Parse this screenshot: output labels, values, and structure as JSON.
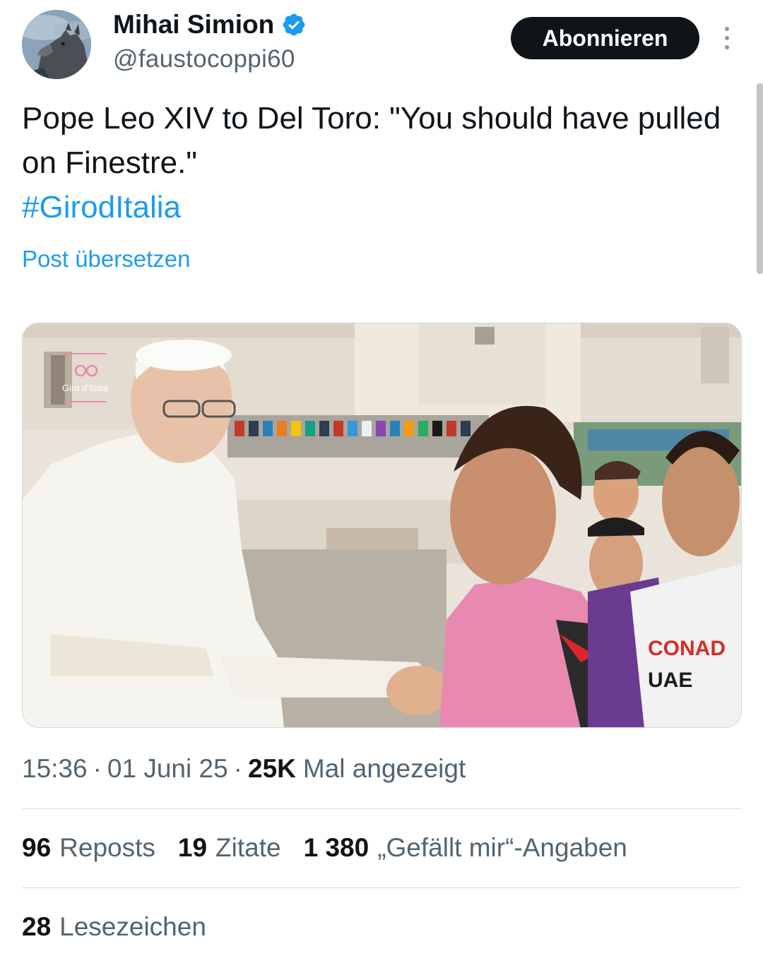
{
  "author": {
    "display_name": "Mihai Simion",
    "handle": "@faustocoppi60",
    "verified": true,
    "avatar_icon": "wolf-avatar"
  },
  "actions": {
    "follow_label": "Abonnieren",
    "more_icon": "more-vertical-icon"
  },
  "tweet": {
    "text": "Pope Leo XIV to Del Toro: \"You should have pulled on Finestre.\"",
    "hashtag": "#GirodItalia",
    "translate_label": "Post übersetzen"
  },
  "media": {
    "overlay_logo": "Giro d'Italia",
    "jersey_text_1": "CONAD",
    "jersey_text_2": "UAE"
  },
  "meta": {
    "time": "15:36",
    "separator": "·",
    "date": "01 Juni 25",
    "views_count": "25K",
    "views_label": "Mal angezeigt"
  },
  "stats": {
    "reposts_count": "96",
    "reposts_label": "Reposts",
    "quotes_count": "19",
    "quotes_label": "Zitate",
    "likes_count": "1 380",
    "likes_label": "„Gefällt mir“-Angaben",
    "bookmarks_count": "28",
    "bookmarks_label": "Lesezeichen"
  },
  "colors": {
    "accent": "#1d9bf0",
    "text_primary": "#0f1419",
    "text_secondary": "#536471",
    "button_bg": "#0f1419",
    "maglia_rosa": "#e889b0"
  }
}
